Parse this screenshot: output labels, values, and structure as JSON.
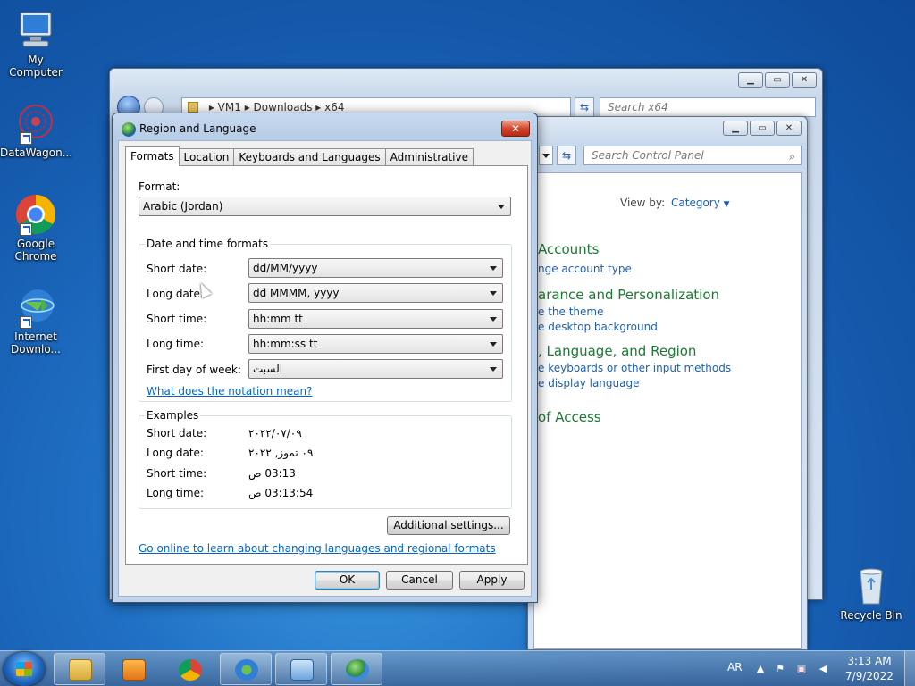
{
  "desktop": {
    "icons": [
      {
        "label": "My Computer",
        "icon": "computer-icon"
      },
      {
        "label": "DataWagon...",
        "icon": "datawagon-icon"
      },
      {
        "label": "Google Chrome",
        "icon": "chrome-icon"
      },
      {
        "label": "Internet Downlo...",
        "icon": "internet-download-manager-icon"
      },
      {
        "label": "Recycle Bin",
        "icon": "recycle-bin-icon"
      }
    ]
  },
  "explorer": {
    "breadcrumb": [
      "VM1",
      "Downloads",
      "x64"
    ],
    "search_placeholder": "Search x64"
  },
  "control_panel": {
    "search_placeholder": "Search Control Panel",
    "view_by_label": "View by:",
    "view_by_value": "Category",
    "sections": [
      {
        "heading": "Accounts",
        "links": [
          "nge account type"
        ]
      },
      {
        "heading": "arance and Personalization",
        "links": [
          "e the theme",
          "e desktop background"
        ]
      },
      {
        "heading": ", Language, and Region",
        "links": [
          "e keyboards or other input methods",
          "e display language"
        ]
      },
      {
        "heading": "of Access",
        "links": []
      }
    ]
  },
  "dialog": {
    "title": "Region and Language",
    "tabs": [
      "Formats",
      "Location",
      "Keyboards and Languages",
      "Administrative"
    ],
    "format_label": "Format:",
    "format_value": "Arabic (Jordan)",
    "datetime_group_title": "Date and time formats",
    "fields": [
      {
        "label": "Short date:",
        "value": "dd/MM/yyyy"
      },
      {
        "label": "Long date:",
        "value": "dd MMMM, yyyy"
      },
      {
        "label": "Short time:",
        "value": "hh:mm tt"
      },
      {
        "label": "Long time:",
        "value": "hh:mm:ss tt"
      },
      {
        "label": "First day of week:",
        "value": "السبت"
      }
    ],
    "notation_link": "What does the notation mean?",
    "examples_group_title": "Examples",
    "examples": [
      {
        "label": "Short date:",
        "value": "٢٠٢٢/٠٧/٠٩"
      },
      {
        "label": "Long date:",
        "value": "٠٩ تموز, ٢٠٢٢"
      },
      {
        "label": "Short time:",
        "value": "03:13 ص"
      },
      {
        "label": "Long time:",
        "value": "03:13:54 ص"
      }
    ],
    "additional_settings": "Additional settings...",
    "online_link": "Go online to learn about changing languages and regional formats",
    "ok": "OK",
    "cancel": "Cancel",
    "apply": "Apply"
  },
  "taskbar": {
    "language": "AR",
    "time": "3:13 AM",
    "date": "7/9/2022"
  }
}
